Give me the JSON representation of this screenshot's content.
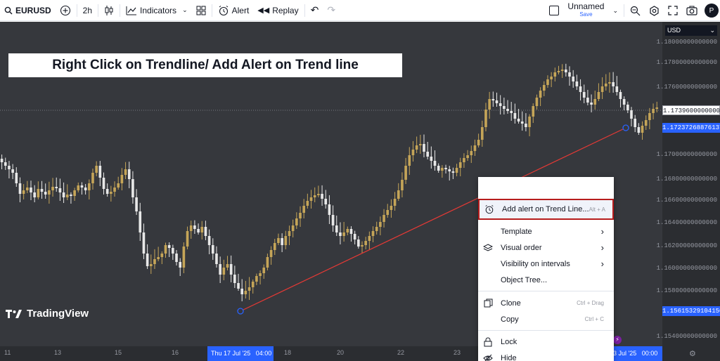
{
  "toolbar": {
    "symbol": "EURUSD",
    "interval": "2h",
    "indicators_label": "Indicators",
    "alert_label": "Alert",
    "replay_label": "Replay",
    "layout_name": "Unnamed",
    "save_label": "Save",
    "avatar_letter": "P"
  },
  "banner": {
    "text": "Right Click on Trendline/ Add Alert on Trend line"
  },
  "logo": {
    "text": "TradingView"
  },
  "price_axis": {
    "currency": "USD",
    "labels": [
      "1.18000000000000",
      "1.17800000000000",
      "1.17600000000000",
      "1.17000000000000",
      "1.16800000000000",
      "1.16600000000000",
      "1.16400000000000",
      "1.16200000000000",
      "1.16000000000000",
      "1.15800000000000",
      "1.15400000000000"
    ],
    "current_price": "1.17396000000000",
    "trend_price_top": "1.17237268876137",
    "trend_price_bottom": "1.15615329104150"
  },
  "time_axis": {
    "labels": [
      "11",
      "13",
      "15",
      "16",
      "18",
      "20",
      "22",
      "23"
    ],
    "cursor_label": "Thu 17 Jul '25   04:00",
    "right_label": "3 Jul '25   00:00"
  },
  "context_menu": {
    "add_alert": {
      "label": "Add alert on Trend Line...",
      "shortcut": "Alt + A"
    },
    "template": "Template",
    "visual_order": "Visual order",
    "visibility": "Visibility on intervals",
    "object_tree": "Object Tree...",
    "clone": {
      "label": "Clone",
      "shortcut": "Ctrl + Drag"
    },
    "copy": {
      "label": "Copy",
      "shortcut": "Ctrl + C"
    },
    "lock": "Lock",
    "hide": "Hide"
  },
  "colors": {
    "chart_bg": "#36383d",
    "candle_up": "#c5a558",
    "candle_down": "#e8e8e8",
    "trendline": "#e53935",
    "accent": "#2962ff",
    "highlight_border": "#b71c1c"
  }
}
